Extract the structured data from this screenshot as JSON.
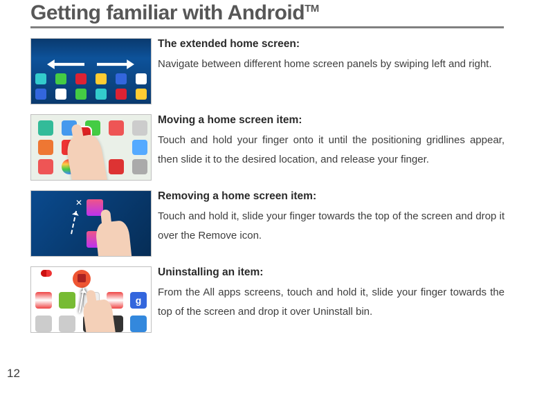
{
  "page_number": "12",
  "title_main": "Getting familiar with Android",
  "title_trademark": "TM",
  "sections": [
    {
      "heading": "The extended home screen:",
      "text": "Navigate between different home screen panels by swiping left and right."
    },
    {
      "heading": "Moving a home screen item:",
      "text": "Touch and hold your finger onto it until the positioning gridlines appear, then slide it to the desired location, and release your finger."
    },
    {
      "heading": "Removing a home screen item:",
      "text": "Touch and hold it, slide your finger towards the top of the screen and drop it over the Remove icon."
    },
    {
      "heading": "Uninstalling an item:",
      "text": "From the All apps screens, touch and hold it, slide your finger towards the top of the screen and drop it over Uninstall bin."
    }
  ]
}
